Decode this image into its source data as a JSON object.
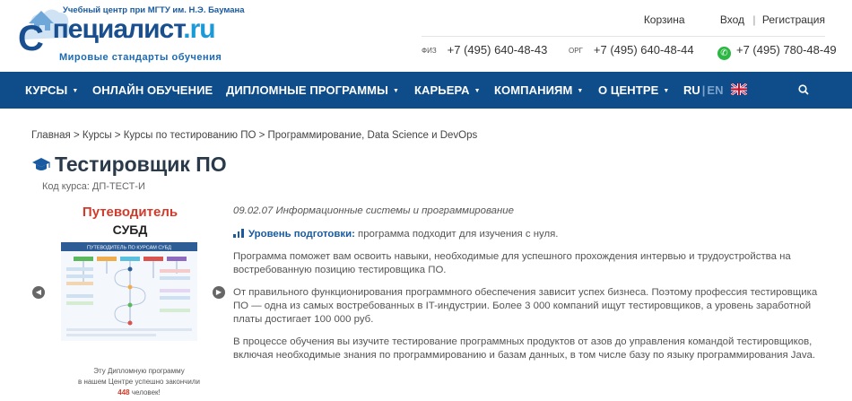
{
  "header": {
    "logo_top": "Учебный центр при МГТУ им. Н.Э. Баумана",
    "logo_main": "пециалист",
    "logo_letter": "С",
    "logo_ru": ".ru",
    "logo_sub": "Мировые стандарты обучения",
    "cart": "Корзина",
    "login": "Вход",
    "sep": "|",
    "register": "Регистрация",
    "phone_fiz_label": "ФИЗ",
    "phone_fiz": "+7 (495) 640-48-43",
    "phone_org_label": "ОРГ",
    "phone_org": "+7 (495) 640-48-44",
    "phone_wa": "+7 (495) 780-48-49",
    "wa_icon": "whatsapp-icon"
  },
  "nav": {
    "items": [
      {
        "label": "КУРСЫ"
      },
      {
        "label": "ОНЛАЙН ОБУЧЕНИЕ"
      },
      {
        "label": "ДИПЛОМНЫЕ ПРОГРАММЫ"
      },
      {
        "label": "КАРЬЕРА"
      },
      {
        "label": "КОМПАНИЯМ"
      },
      {
        "label": "О ЦЕНТРЕ"
      }
    ],
    "lang_ru": "RU",
    "lang_sep": "|",
    "lang_en": "EN"
  },
  "breadcrumbs": "Главная > Курсы > Курсы по тестированию ПО > Программирование, Data Science и DevOps",
  "page": {
    "title": "Тестировщик ПО",
    "code": "Код курса: ДП-ТЕСТ-И"
  },
  "guide": {
    "title1": "Путеводитель",
    "title2": "СУБД",
    "image_caption": "ПУТЕВОДИТЕЛЬ ПО КУРСАМ СУБД",
    "note1": "Эту Дипломную программу",
    "note2": "в нашем Центре успешно закончили",
    "count": "448",
    "note3": "человек!"
  },
  "content": {
    "specialty": "09.02.07 Информационные системы и программирование",
    "level_label": "Уровень подготовки:",
    "level_value": "программа подходит для изучения с нуля.",
    "p1": "Программа поможет вам освоить навыки, необходимые для успешного прохождения интервью и трудоустройства на востребованную позицию тестировщика ПО.",
    "p2": "От правильного функционирования программного обеспечения зависит успех бизнеса. Поэтому профессия тестировщика ПО — одна из самых востребованных в IT-индустрии. Более 3 000 компаний ищут тестировщиков, а уровень заработной платы достигает 100 000 руб.",
    "p3": "В процессе обучения вы изучите тестирование программных продуктов от азов до управления командой тестировщиков, включая необходимые знания по программированию и базам данных, в том числе базу по языку программирования Java."
  },
  "colors": {
    "nav_bg": "#0f4d8a",
    "accent_red": "#d23b2b",
    "brand_blue": "#1a5aa0"
  }
}
